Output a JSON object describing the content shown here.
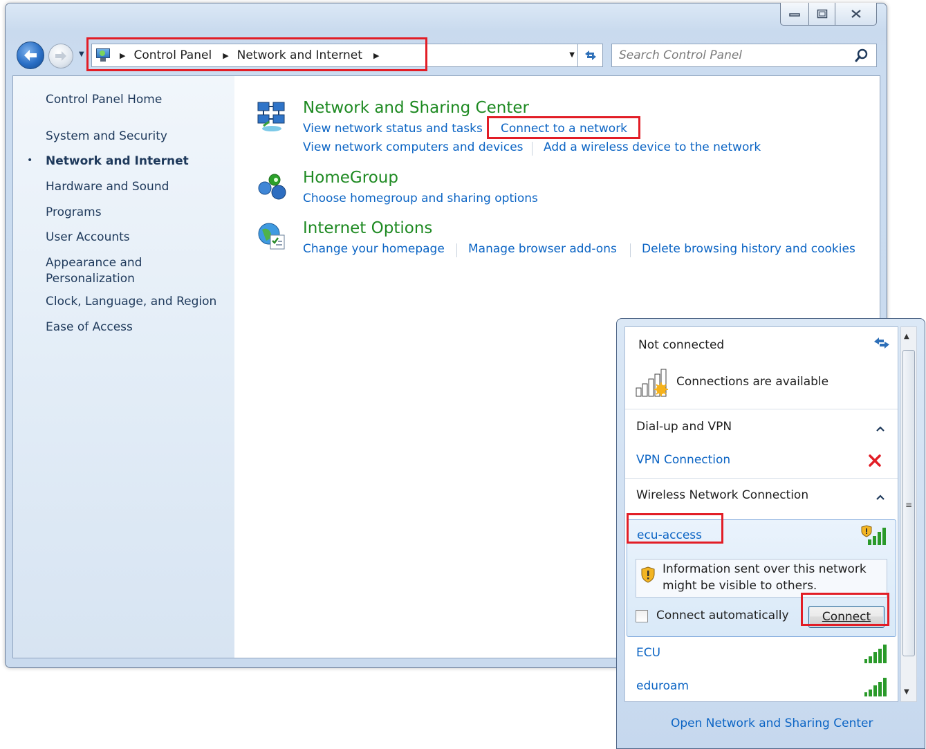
{
  "window": {
    "caption_buttons": [
      "minimize",
      "maximize",
      "close"
    ]
  },
  "address_bar": {
    "breadcrumbs": [
      "Control Panel",
      "Network and Internet"
    ]
  },
  "search": {
    "placeholder": "Search Control Panel"
  },
  "sidebar": {
    "items": [
      {
        "label": "Control Panel Home",
        "active": false
      },
      {
        "label": "System and Security",
        "active": false
      },
      {
        "label": "Network and Internet",
        "active": true
      },
      {
        "label": "Hardware and Sound",
        "active": false
      },
      {
        "label": "Programs",
        "active": false
      },
      {
        "label": "User Accounts",
        "active": false
      },
      {
        "label": "Appearance and Personalization",
        "active": false,
        "lines": [
          "Appearance and",
          "Personalization"
        ]
      },
      {
        "label": "Clock, Language, and Region",
        "active": false
      },
      {
        "label": "Ease of Access",
        "active": false
      }
    ],
    "bullet": "•"
  },
  "sections": [
    {
      "title": "Network and Sharing Center",
      "icon": "network-sharing-icon",
      "links": [
        "View network status and tasks",
        "Connect to a network",
        "View network computers and devices",
        "Add a wireless device to the network"
      ]
    },
    {
      "title": "HomeGroup",
      "icon": "homegroup-icon",
      "links": [
        "Choose homegroup and sharing options"
      ]
    },
    {
      "title": "Internet Options",
      "icon": "internet-options-icon",
      "links": [
        "Change your homepage",
        "Manage browser add-ons",
        "Delete browsing history and cookies"
      ]
    }
  ],
  "flyout": {
    "status": "Not connected",
    "availability": "Connections are available",
    "groups": [
      {
        "label": "Dial-up and VPN",
        "items": [
          "VPN Connection"
        ]
      },
      {
        "label": "Wireless Network Connection",
        "items": [
          "ecu-access",
          "ECU",
          "eduroam"
        ]
      }
    ],
    "selected_network": {
      "name": "ecu-access",
      "warning": [
        "Information sent over this network",
        "might be visible to others."
      ],
      "auto_connect_label": "Connect automatically",
      "auto_connect_checked": false,
      "connect_label": "Connect"
    },
    "footer_link": "Open Network and Sharing Center"
  },
  "colors": {
    "link": "#0b64c4",
    "section_title": "#1e8a22",
    "highlight_box": "#e21d26",
    "vpn_error": "#e21d26"
  }
}
